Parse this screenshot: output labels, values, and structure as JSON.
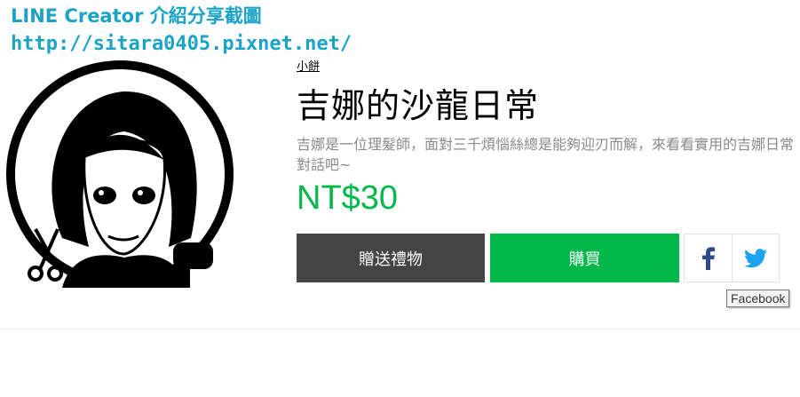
{
  "watermark": {
    "line1": "LINE Creator 介紹分享截圖",
    "line2": "http://sitara0405.pixnet.net/"
  },
  "product": {
    "author": "小餅",
    "title": "吉娜的沙龍日常",
    "description": "吉娜是一位理髮師，面對三千煩惱絲總是能夠迎刃而解，來看看實用的吉娜日常對話吧~",
    "price": "NT$30"
  },
  "actions": {
    "gift_label": "贈送禮物",
    "buy_label": "購買"
  },
  "share": {
    "facebook_icon": "facebook-icon",
    "twitter_icon": "twitter-icon",
    "tooltip": "Facebook"
  },
  "colors": {
    "accent_green": "#00b84a",
    "gift_gray": "#444444",
    "watermark": "#1aa3c7",
    "facebook": "#3b5998",
    "twitter": "#1da1f2"
  }
}
